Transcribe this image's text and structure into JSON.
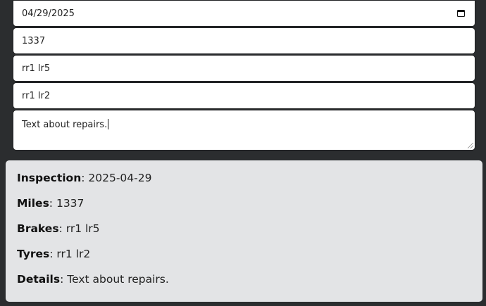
{
  "form": {
    "inspection_date": "04/29/2025",
    "miles": "1337",
    "brakes": "rr1 lr5",
    "tyres": "rr1 lr2",
    "details": "Text about repairs."
  },
  "summary": {
    "inspection_label": "Inspection",
    "inspection_value": "2025-04-29",
    "miles_label": "Miles",
    "miles_value": "1337",
    "brakes_label": "Brakes",
    "brakes_value": "rr1 lr5",
    "tyres_label": "Tyres",
    "tyres_value": "rr1 lr2",
    "details_label": "Details",
    "details_value": "Text about repairs."
  },
  "icons": {
    "date_picker": "calendar-icon"
  }
}
